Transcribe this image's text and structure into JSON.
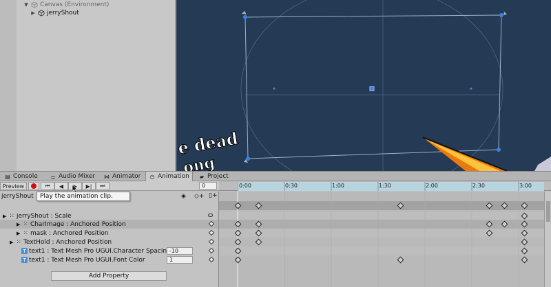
{
  "hierarchy": {
    "items": [
      {
        "label": "Canvas (Environment)"
      },
      {
        "label": "jerryShout"
      }
    ]
  },
  "scene": {
    "overlay_text_1": "e dead",
    "overlay_text_2": "ong"
  },
  "tabs": [
    {
      "label": "Console",
      "icon": "console-icon"
    },
    {
      "label": "Audio Mixer",
      "icon": "audio-mixer-icon"
    },
    {
      "label": "Animator",
      "icon": "animator-icon"
    },
    {
      "label": "Animation",
      "icon": "animation-icon"
    },
    {
      "label": "Project",
      "icon": "folder-icon"
    }
  ],
  "toolbar": {
    "preview_label": "Preview",
    "frame_value": "0",
    "clip_name": "jerryShout",
    "tooltip": "Play the animation clip."
  },
  "ruler": {
    "labels": [
      "0:00",
      "0:30",
      "1:00",
      "1:30",
      "2:00",
      "2:30",
      "3:00"
    ]
  },
  "properties": [
    {
      "label": "jerryShout : Scale",
      "value": ""
    },
    {
      "label": "CharImage : Anchored Position",
      "value": ""
    },
    {
      "label": "mask : Anchored Position",
      "value": ""
    },
    {
      "label": "TextHold : Anchored Position",
      "value": ""
    },
    {
      "label": "text1 : Text Mesh Pro UGUI.Character Spacing",
      "value": "-10"
    },
    {
      "label": "text1 : Text Mesh Pro UGUI.Font Color",
      "value": "1"
    }
  ],
  "add_property_label": "Add Property",
  "colors": {
    "scene_bg": "#243a55",
    "ruler_bar": "#b7d5de",
    "record_red": "#d01010"
  }
}
